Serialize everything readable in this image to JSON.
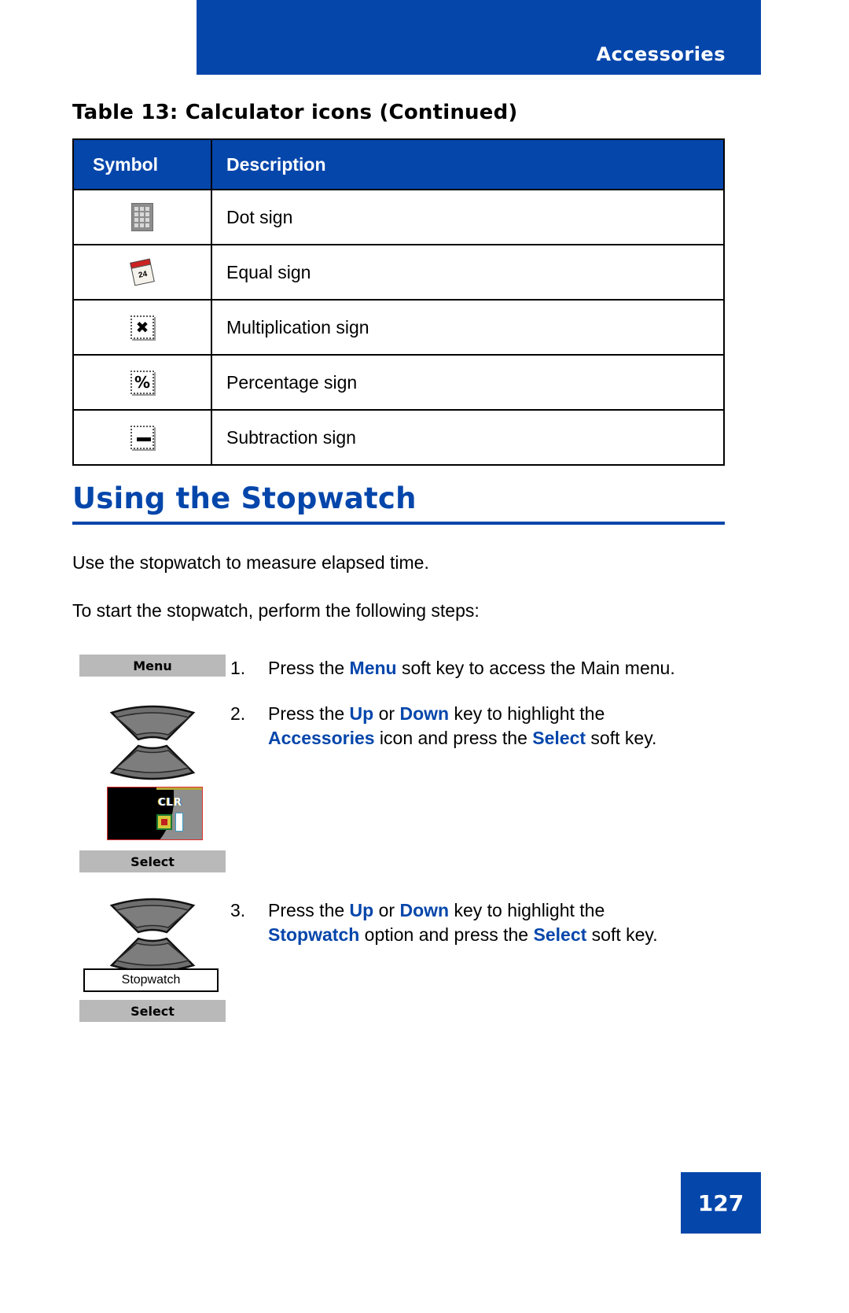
{
  "header": {
    "title": "Accessories",
    "band_color": "#0546ab"
  },
  "table": {
    "caption": "Table 13: Calculator icons (Continued)",
    "columns": [
      "Symbol",
      "Description"
    ],
    "rows": [
      {
        "symbol_icon": "keypad-icon",
        "description": "Dot sign"
      },
      {
        "symbol_icon": "calendar-icon",
        "description": "Equal sign"
      },
      {
        "symbol_icon": "multiplication-icon",
        "description": "Multiplication sign"
      },
      {
        "symbol_icon": "percentage-icon",
        "description": "Percentage sign"
      },
      {
        "symbol_icon": "subtraction-icon",
        "description": "Subtraction sign"
      }
    ],
    "calendar_day": "24",
    "multiplication_glyph": "✖",
    "percentage_glyph": "%"
  },
  "section": {
    "heading": "Using the Stopwatch",
    "paragraph_1": "Use the stopwatch to measure elapsed time.",
    "paragraph_2": "To start the stopwatch, perform the following steps:"
  },
  "steps": [
    {
      "number": "1.",
      "line1_pre": "Press the ",
      "line1_b1": "Menu",
      "line1_mid": " soft key to access the Main menu.",
      "softkey_label": "Menu"
    },
    {
      "number": "2.",
      "line1_pre": "Press the ",
      "line1_b1": "Up",
      "line1_mid1": " or ",
      "line1_b2": "Down",
      "line1_post": " key to highlight the",
      "line2_b1": "Accessories",
      "line2_mid": " icon and press the ",
      "line2_b2": "Select",
      "line2_post": " soft key.",
      "softkey_label": "Select",
      "screen_text": "CLR"
    },
    {
      "number": "3.",
      "line1_pre": "Press the ",
      "line1_b1": "Up",
      "line1_mid1": " or ",
      "line1_b2": "Down",
      "line1_post": " key to highlight the",
      "line2_b1": "Stopwatch",
      "line2_mid": " option and press the ",
      "line2_b2": "Select",
      "line2_post": " soft key.",
      "option_label": "Stopwatch",
      "softkey_label": "Select"
    }
  ],
  "footer": {
    "page_number": "127"
  }
}
